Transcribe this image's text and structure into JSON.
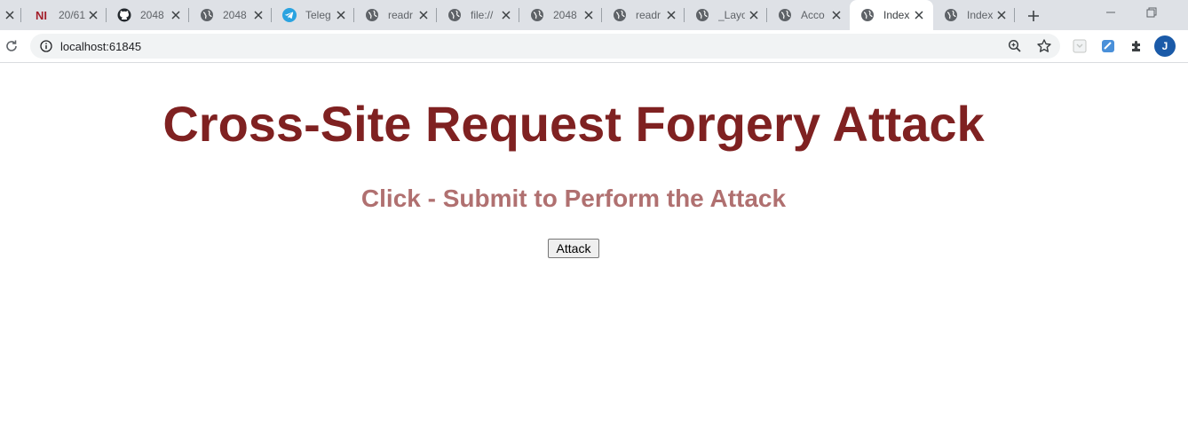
{
  "browser": {
    "tabs": [
      {
        "title": "",
        "icon": "close-icon"
      },
      {
        "title": "20/61",
        "icon": "ni-logo-icon"
      },
      {
        "title": "2048",
        "icon": "github-icon"
      },
      {
        "title": "2048",
        "icon": "globe-icon"
      },
      {
        "title": "Teleg",
        "icon": "telegram-icon"
      },
      {
        "title": "readr",
        "icon": "globe-icon"
      },
      {
        "title": "file://",
        "icon": "globe-icon"
      },
      {
        "title": "2048",
        "icon": "globe-icon"
      },
      {
        "title": "readr",
        "icon": "globe-icon"
      },
      {
        "title": "_Layo",
        "icon": "globe-icon"
      },
      {
        "title": "Acco",
        "icon": "globe-icon"
      },
      {
        "title": "Index",
        "icon": "globe-icon",
        "active": true
      },
      {
        "title": "Index",
        "icon": "globe-icon"
      }
    ],
    "url": "localhost:61845",
    "profile_initial": "J"
  },
  "page": {
    "heading": "Cross-Site Request Forgery Attack",
    "subheading": "Click - Submit to Perform the Attack",
    "button_label": "Attack"
  },
  "colors": {
    "heading": "#7f2121",
    "subheading": "#b07070",
    "tabstrip": "#dee1e6",
    "avatar": "#1a5aa8"
  }
}
